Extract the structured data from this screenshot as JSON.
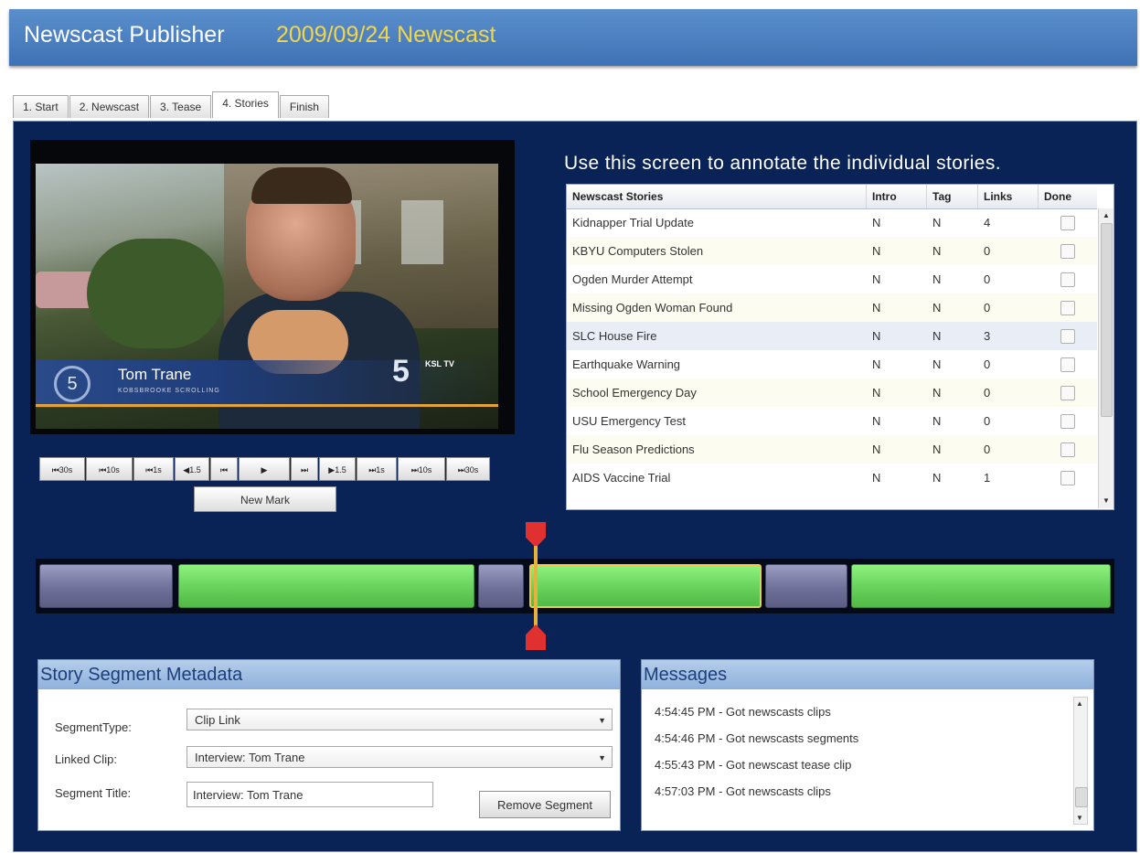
{
  "header": {
    "app_title": "Newscast Publisher",
    "newscast_title": "2009/09/24 Newscast"
  },
  "tabs": [
    {
      "label": "1. Start"
    },
    {
      "label": "2. Newscast"
    },
    {
      "label": "3. Tease"
    },
    {
      "label": "4. Stories"
    },
    {
      "label": "Finish"
    }
  ],
  "active_tab": "4. Stories",
  "video": {
    "lower_third_name": "Tom Trane",
    "lower_third_subtitle": "KOBSBROOKE SCROLLING",
    "station_number": "5",
    "station_call": "KSL TV"
  },
  "transport": {
    "buttons": [
      "⏮30s",
      "⏮10s",
      "⏮1s",
      "◀1.5",
      "⏮",
      "▶",
      "⏭",
      "▶1.5",
      "⏭1s",
      "⏭10s",
      "⏭30s"
    ],
    "new_mark": "New Mark"
  },
  "instruction": "Use this screen to annotate the individual stories.",
  "stories": {
    "headers": {
      "title": "Newscast Stories",
      "intro": "Intro",
      "tag": "Tag",
      "links": "Links",
      "done": "Done"
    },
    "rows": [
      {
        "title": "Kidnapper Trial Update",
        "intro": "N",
        "tag": "N",
        "links": "4"
      },
      {
        "title": "KBYU Computers Stolen",
        "intro": "N",
        "tag": "N",
        "links": "0"
      },
      {
        "title": "Ogden Murder Attempt",
        "intro": "N",
        "tag": "N",
        "links": "0"
      },
      {
        "title": "Missing Ogden Woman Found",
        "intro": "N",
        "tag": "N",
        "links": "0"
      },
      {
        "title": "SLC House Fire",
        "intro": "N",
        "tag": "N",
        "links": "3"
      },
      {
        "title": "Earthquake Warning",
        "intro": "N",
        "tag": "N",
        "links": "0"
      },
      {
        "title": "School Emergency Day",
        "intro": "N",
        "tag": "N",
        "links": "0"
      },
      {
        "title": "USU Emergency Test",
        "intro": "N",
        "tag": "N",
        "links": "0"
      },
      {
        "title": "Flu Season Predictions",
        "intro": "N",
        "tag": "N",
        "links": "0"
      },
      {
        "title": "AIDS Vaccine Trial",
        "intro": "N",
        "tag": "N",
        "links": "1"
      }
    ]
  },
  "metadata": {
    "title": "Story Segment Metadata",
    "segment_type_label": "SegmentType:",
    "segment_type_value": "Clip Link",
    "linked_clip_label": "Linked Clip:",
    "linked_clip_value": "Interview: Tom Trane",
    "segment_title_label": "Segment Title:",
    "segment_title_value": "Interview: Tom Trane",
    "remove_button": "Remove Segment"
  },
  "messages": {
    "title": "Messages",
    "items": [
      "4:54:45 PM - Got newscasts clips",
      "4:54:46 PM - Got newscasts segments",
      "4:55:43 PM - Got newscast tease clip",
      "4:57:03 PM - Got newscasts clips"
    ]
  },
  "colors": {
    "panel": "#0a2357",
    "accent_title": "#f2d64a",
    "segment_green": "#66d15b",
    "segment_gray": "#6e7099",
    "playhead": "#e03030"
  }
}
